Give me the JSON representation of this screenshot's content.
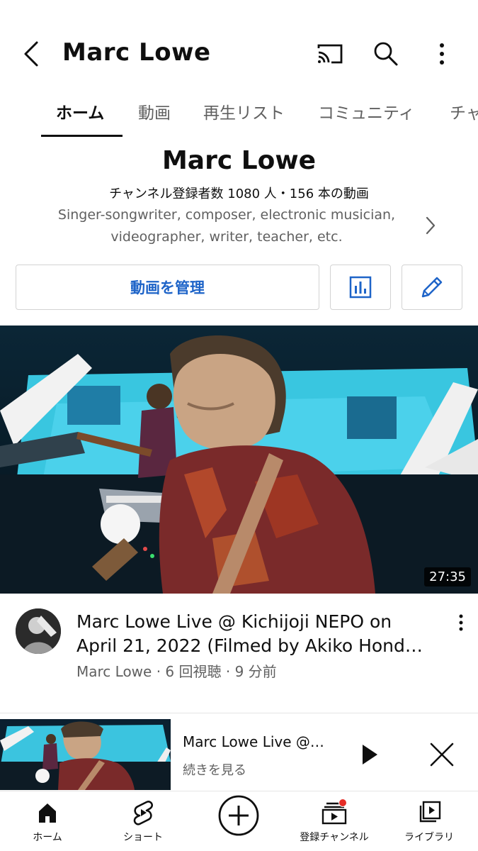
{
  "appbar": {
    "title": "Marc Lowe",
    "icons": [
      "back-arrow-icon",
      "cast-icon",
      "search-icon",
      "more-vert-icon"
    ]
  },
  "tabs": [
    {
      "label": "ホーム",
      "active": true
    },
    {
      "label": "動画",
      "active": false
    },
    {
      "label": "再生リスト",
      "active": false
    },
    {
      "label": "コミュニティ",
      "active": false
    },
    {
      "label": "チャ",
      "active": false
    }
  ],
  "channel": {
    "name": "Marc Lowe",
    "stats": "チャンネル登録者数 1080 人・156 本の動画",
    "description_line1": "Singer-songwriter, composer, electronic musician,",
    "description_line2": "videographer, writer, teacher, etc."
  },
  "actions": {
    "manage_label": "動画を管理",
    "analytics_icon": "analytics-icon",
    "edit_icon": "pencil-icon"
  },
  "video": {
    "duration": "27:35",
    "title_line1": "Marc Lowe Live @ Kichijoji NEPO on",
    "title_line2": "April 21, 2022 (Filmed by Akiko Hond…",
    "meta": "Marc Lowe · 6 回視聴 · 9 分前"
  },
  "mini_player": {
    "title": "Marc Lowe Live @…",
    "subtitle": "続きを見る"
  },
  "bottom_nav": [
    {
      "label": "ホーム",
      "icon": "home-icon"
    },
    {
      "label": "ショート",
      "icon": "shorts-icon"
    },
    {
      "label": "",
      "icon": "create-plus-icon"
    },
    {
      "label": "登録チャンネル",
      "icon": "subscriptions-icon"
    },
    {
      "label": "ライブラリ",
      "icon": "library-icon"
    }
  ],
  "colors": {
    "accent_blue": "#1e64c8",
    "text_primary": "#0f0f0f",
    "text_secondary": "#606060",
    "notification_red": "#e52d27"
  }
}
